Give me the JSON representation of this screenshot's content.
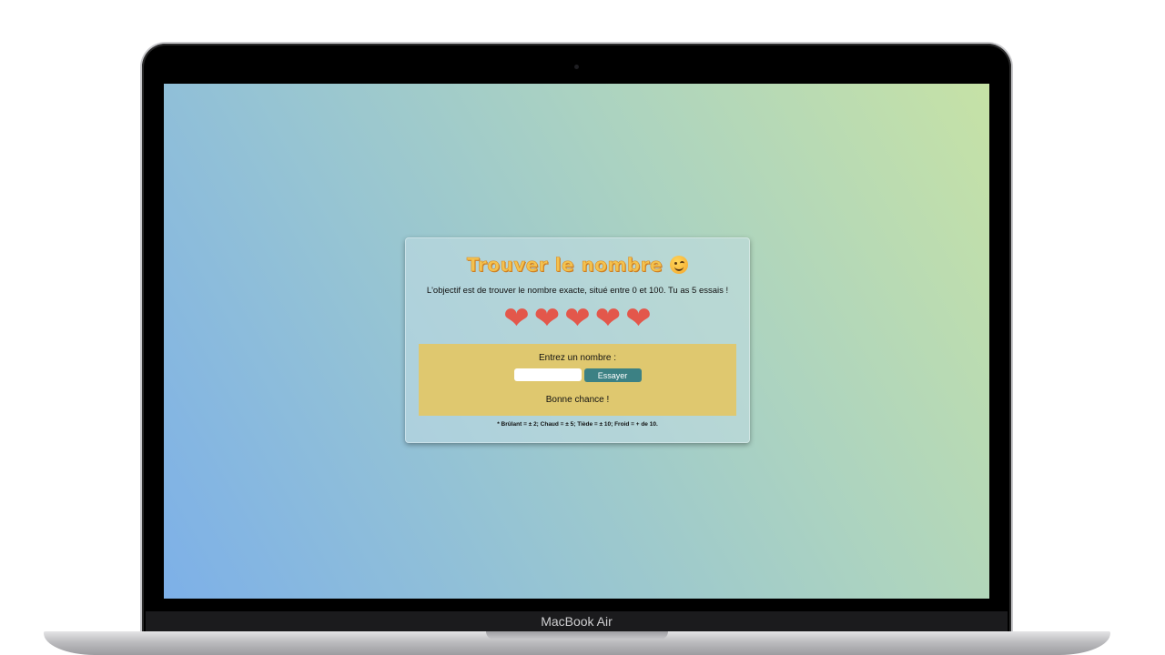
{
  "device": {
    "brand_label": "MacBook Air"
  },
  "game": {
    "title": "Trouver le nombre",
    "title_emoji": "winking-face-icon",
    "description": "L'objectif est de trouver le nombre exacte, situé entre 0 et 100. Tu as 5 essais !",
    "lives": 5,
    "heart_glyph": "❤",
    "form": {
      "label": "Entrez un nombre :",
      "input_value": "",
      "button_label": "Essayer"
    },
    "status": "Bonne chance !",
    "footnote": "* Brûlant = ± 2; Chaud = ± 5; Tiède = ± 10; Froid = + de 10."
  },
  "colors": {
    "heart": "#e3574b",
    "panel": "#dfc86f",
    "button": "#3c8184",
    "title": "#f3c24f"
  }
}
